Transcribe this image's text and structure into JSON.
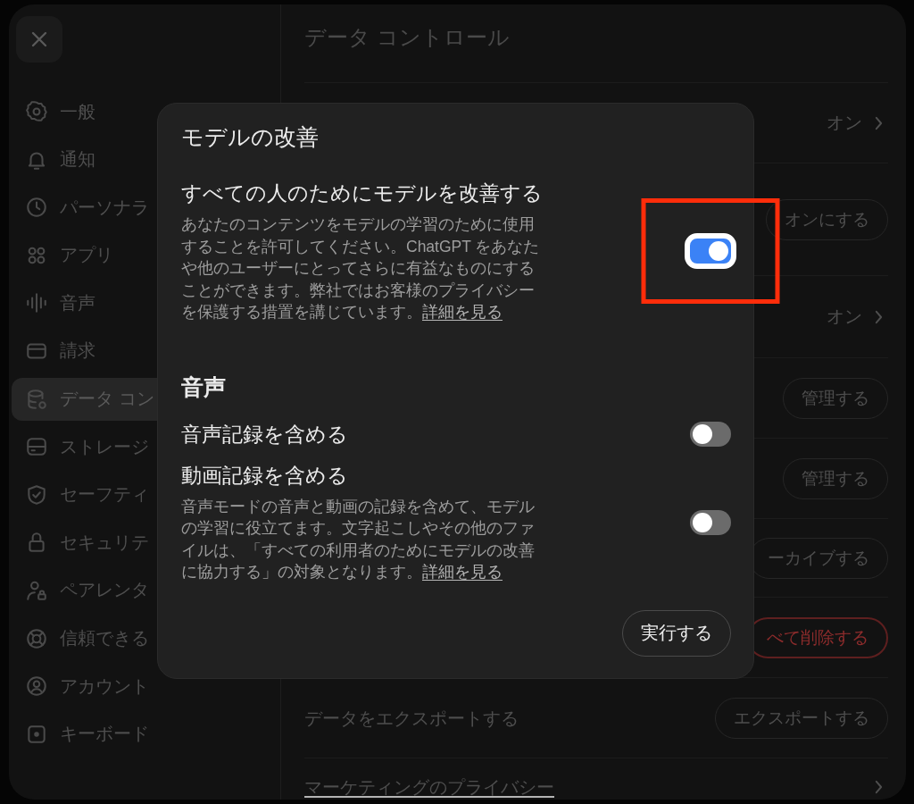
{
  "sidebar": {
    "items": [
      {
        "label": "一般",
        "selected": false
      },
      {
        "label": "通知",
        "selected": false
      },
      {
        "label": "パーソナラ",
        "selected": false
      },
      {
        "label": "アプリ",
        "selected": false
      },
      {
        "label": "音声",
        "selected": false
      },
      {
        "label": "請求",
        "selected": false
      },
      {
        "label": "データ コン",
        "selected": true
      },
      {
        "label": "ストレージ",
        "selected": false
      },
      {
        "label": "セーフティ",
        "selected": false
      },
      {
        "label": "セキュリテ",
        "selected": false
      },
      {
        "label": "ペアレンタ",
        "selected": false
      },
      {
        "label": "信頼できる",
        "selected": false
      },
      {
        "label": "アカウント",
        "selected": false
      },
      {
        "label": "キーボード",
        "selected": false
      }
    ]
  },
  "page": {
    "title": "データ コントロール",
    "rows": [
      {
        "kind": "value",
        "value": "オン"
      },
      {
        "kind": "button",
        "button": "オンにする"
      },
      {
        "kind": "value",
        "value": "オン"
      },
      {
        "kind": "button",
        "button": "管理する"
      },
      {
        "kind": "button",
        "button": "管理する"
      },
      {
        "kind": "button",
        "button": "ーカイブする"
      },
      {
        "kind": "danger_button",
        "button": "べて削除する"
      },
      {
        "kind": "button",
        "label": "データをエクスポートする",
        "button": "エクスポートする"
      },
      {
        "kind": "link",
        "label": "マーケティングのプライバシー"
      }
    ]
  },
  "dialog": {
    "title": "モデルの改善",
    "sections": [
      {
        "settings": [
          {
            "title": "すべての人のためにモデルを改善する",
            "description": "あなたのコンテンツをモデルの学習のために使用することを許可してください。ChatGPT をあなたや他のユーザーにとってさらに有益なものにすることができます。弊社ではお客様のプライバシーを保護する措置を講じています。",
            "link": "詳細を見る",
            "on": true,
            "focused": true,
            "highlighted": true
          }
        ]
      },
      {
        "heading": "音声",
        "settings": [
          {
            "title": "音声記録を含める",
            "on": false,
            "focused": false,
            "highlighted": false
          },
          {
            "title": "動画記録を含める",
            "description": "音声モードの音声と動画の記録を含めて、モデルの学習に役立てます。文字起こしやその他のファイルは、「すべての利用者のためにモデルの改善に協力する」の対象となります。",
            "link": "詳細を見る",
            "on": false,
            "focused": false,
            "highlighted": false
          }
        ]
      }
    ],
    "button": "実行する"
  }
}
